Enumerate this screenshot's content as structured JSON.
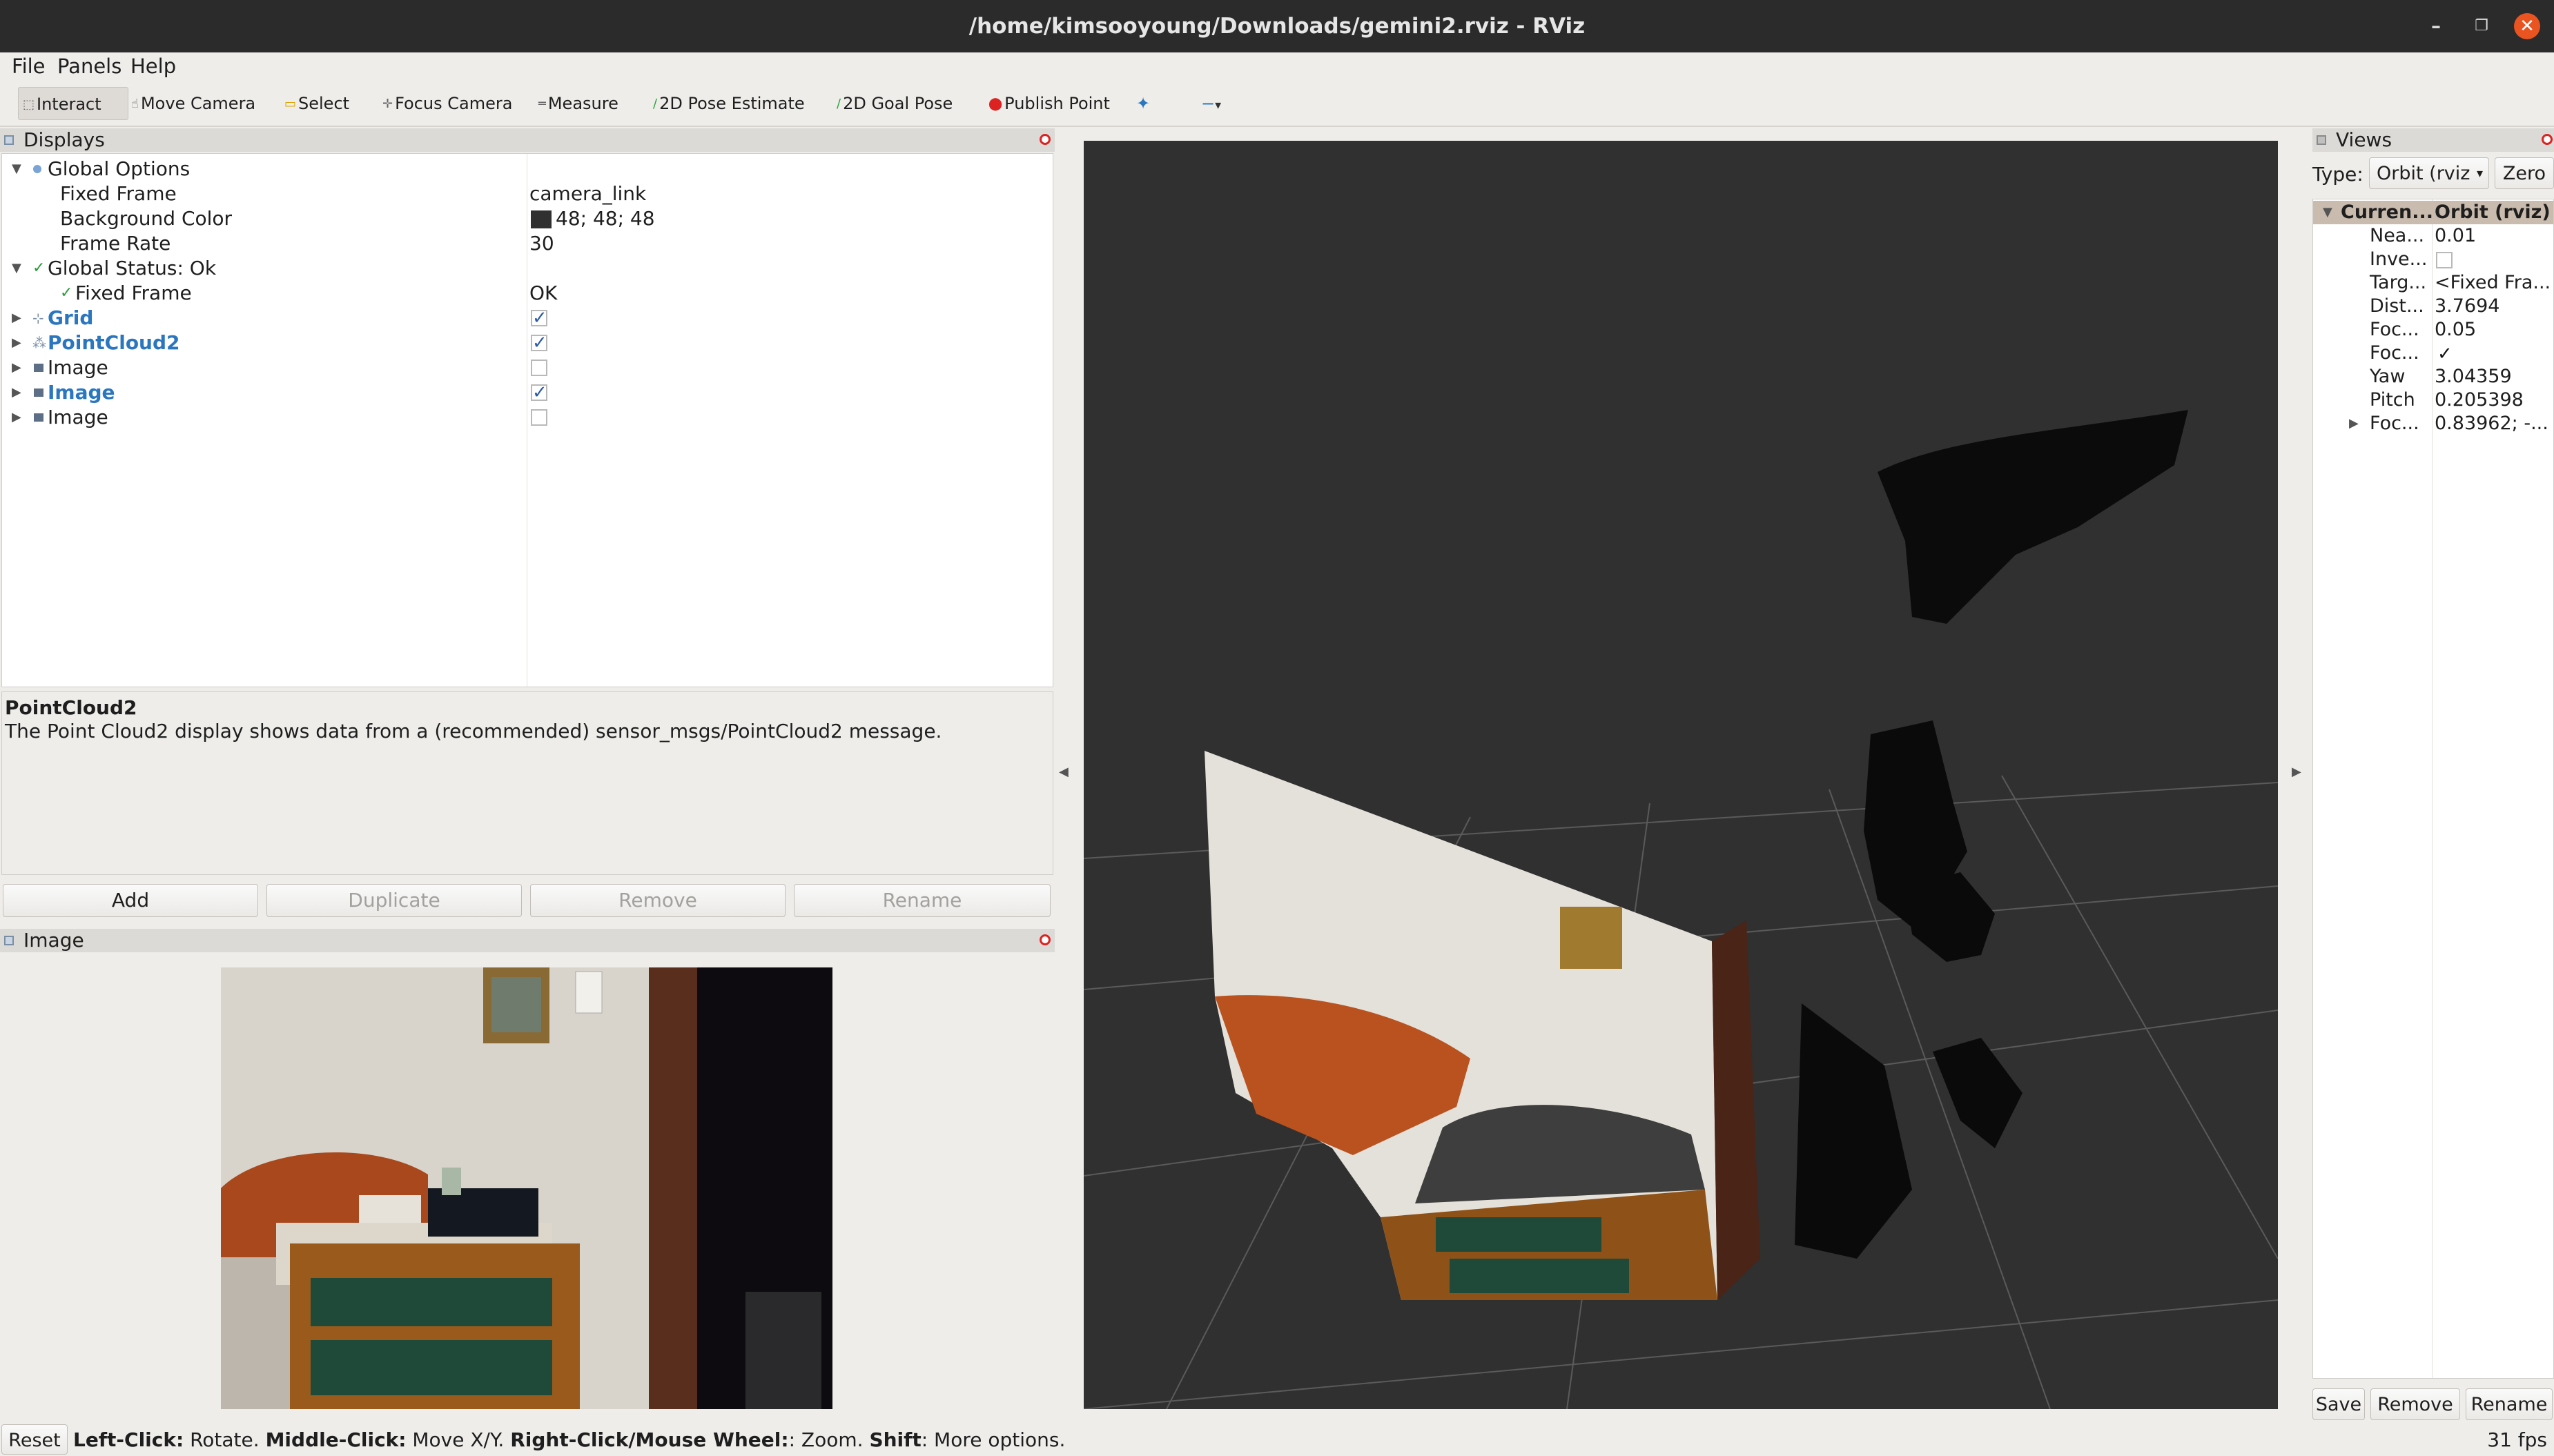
{
  "window": {
    "title": "/home/kimsooyoung/Downloads/gemini2.rviz - RViz"
  },
  "menu": [
    "File",
    "Panels",
    "Help"
  ],
  "toolbar": {
    "tools": [
      "Interact",
      "Move Camera",
      "Select",
      "Focus Camera",
      "Measure",
      "2D Pose Estimate",
      "2D Goal Pose",
      "Publish Point"
    ],
    "active": "Interact"
  },
  "displays": {
    "header": "Displays",
    "global_options": {
      "label": "Global Options",
      "fixed_frame_label": "Fixed Frame",
      "fixed_frame": "camera_link",
      "bg_label": "Background Color",
      "bg_value": "48; 48; 48",
      "bg_color": "#303030",
      "rate_label": "Frame Rate",
      "rate": "30"
    },
    "global_status": {
      "label": "Global Status: Ok",
      "fixed_frame_label": "Fixed Frame",
      "fixed_frame_value": "OK"
    },
    "items": [
      {
        "label": "Grid",
        "checked": true,
        "highlight": true
      },
      {
        "label": "PointCloud2",
        "checked": true,
        "highlight": true
      },
      {
        "label": "Image",
        "checked": false,
        "highlight": false
      },
      {
        "label": "Image",
        "checked": true,
        "highlight": true
      },
      {
        "label": "Image",
        "checked": false,
        "highlight": false
      }
    ],
    "description_title": "PointCloud2",
    "description_text": "The Point Cloud2 display shows data from a (recommended) sensor_msgs/PointCloud2 message.",
    "buttons": {
      "add": "Add",
      "duplicate": "Duplicate",
      "remove": "Remove",
      "rename": "Rename"
    }
  },
  "image_panel": {
    "header": "Image"
  },
  "views": {
    "header": "Views",
    "type_label": "Type:",
    "type_value": "Orbit (rviz",
    "zero": "Zero",
    "current_label": "Curren...",
    "current_value": "Orbit (rviz)",
    "props": [
      {
        "name": "Nea...",
        "value": "0.01"
      },
      {
        "name": "Inve...",
        "value": ""
      },
      {
        "name": "Targ...",
        "value": "<Fixed Fra..."
      },
      {
        "name": "Dist...",
        "value": "3.7694"
      },
      {
        "name": "Foc...",
        "value": "0.05"
      },
      {
        "name": "Foc...",
        "value": ""
      },
      {
        "name": "Yaw",
        "value": "3.04359"
      },
      {
        "name": "Pitch",
        "value": "0.205398"
      },
      {
        "name": "Foc...",
        "value": "0.83962; -..."
      }
    ],
    "buttons": {
      "save": "Save",
      "remove": "Remove",
      "rename": "Rename"
    }
  },
  "statusbar": {
    "reset": "Reset",
    "k1": "Left-Click:",
    "v1": " Rotate. ",
    "k2": "Middle-Click:",
    "v2": " Move X/Y. ",
    "k3": "Right-Click/Mouse Wheel:",
    "v3": ": Zoom. ",
    "k4": "Shift",
    "v4": ": More options.",
    "fps": "31 fps"
  }
}
